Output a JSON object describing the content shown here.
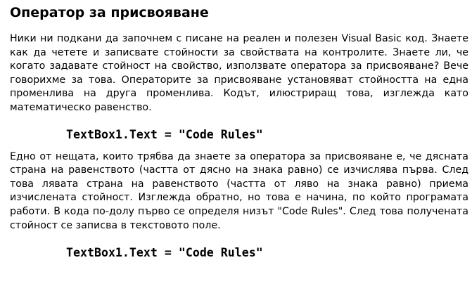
{
  "document": {
    "heading": "Оператор за присвояване",
    "paragraph1": "Ники ни подкани да започнем с писане на реален и полезен Visual Basic код. Знаете как да четете и записвате стойности за свойствата на контролите. Знаете ли, че когато задавате стойност на свойство, използвате оператора за присвояване? Вече говорихме за това. Операторите за присвояване установяват стойността на една променлива на друга променлива. Кодът, илюстриращ това, изглежда като математическо равенство.",
    "code1": "TextBox1.Text = \"Code Rules\"",
    "paragraph2": "Едно от нещата, които трябва да знаете за оператора за присвояване е, че дясната страна на равенството (частта от дясно на знака равно) се изчислява първа. След това лявата  страна на равенството (частта от ляво на знака равно) приема изчислената стойност. Изглежда обратно, но това е начина, по който програмата работи. В кода по-долу първо се определя низът \"Code Rules\". След това получената стойност се записва в текстовото поле.",
    "code2": "TextBox1.Text = \"Code Rules\""
  }
}
